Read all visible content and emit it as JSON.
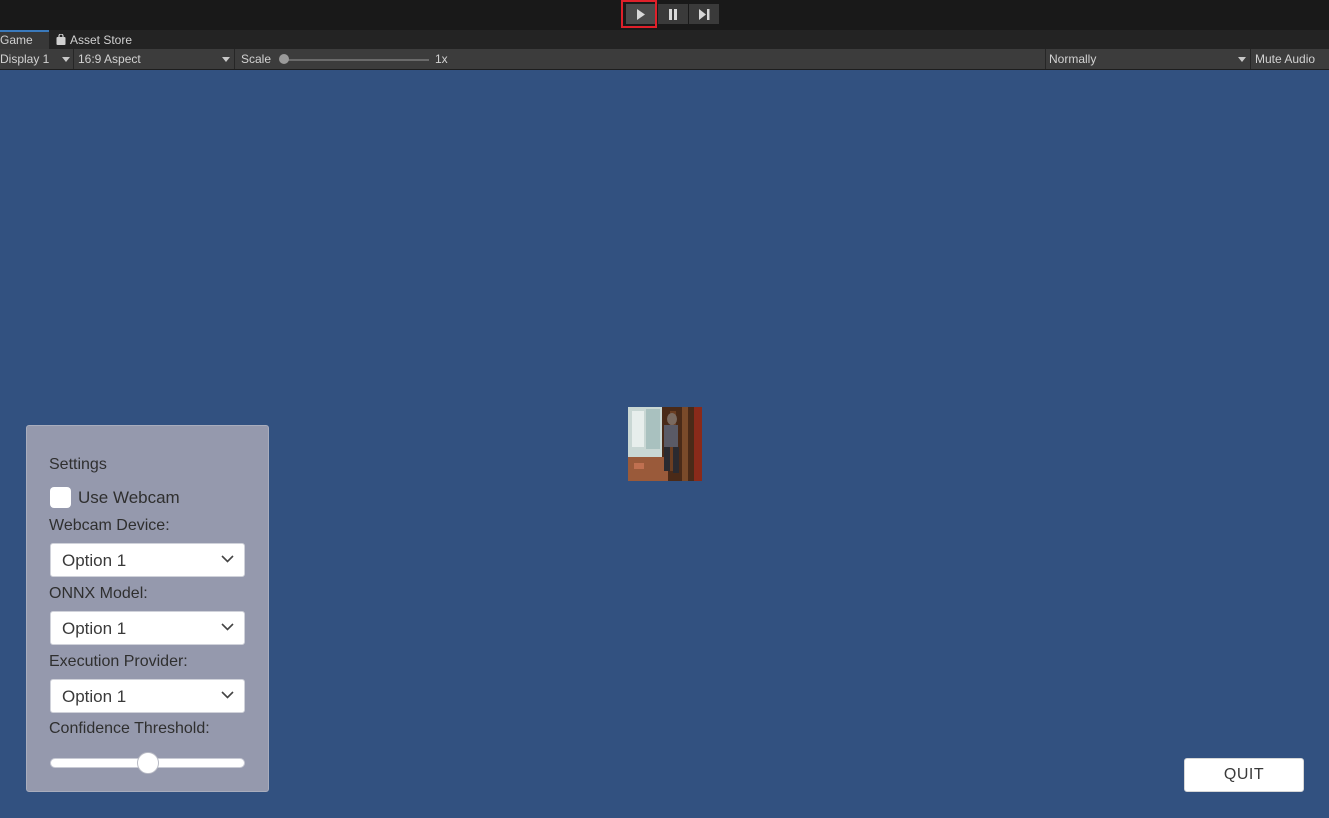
{
  "playbar": {
    "play_icon": "play-icon",
    "pause_icon": "pause-icon",
    "step_icon": "step-icon",
    "highlight_color": "#e0202a"
  },
  "tabs": {
    "game": "Game",
    "asset_store": "Asset Store"
  },
  "toolbar": {
    "display": "Display 1",
    "aspect": "16:9 Aspect",
    "scale_label": "Scale",
    "scale_value": "1x",
    "scale_fraction": 0.0,
    "play_mode": "Normally",
    "mute": "Mute Audio"
  },
  "settings": {
    "title": "Settings",
    "use_webcam_label": "Use Webcam",
    "use_webcam_checked": false,
    "webcam_device_label": "Webcam Device:",
    "webcam_device_value": "Option 1",
    "onnx_model_label": "ONNX Model:",
    "onnx_model_value": "Option 1",
    "execution_provider_label": "Execution Provider:",
    "execution_provider_value": "Option 1",
    "confidence_label": "Confidence Threshold:",
    "confidence_fraction": 0.5
  },
  "quit_label": "QUIT",
  "colors": {
    "background": "#325180",
    "panel": "#9599ad",
    "tab_accent": "#3a79bb"
  }
}
